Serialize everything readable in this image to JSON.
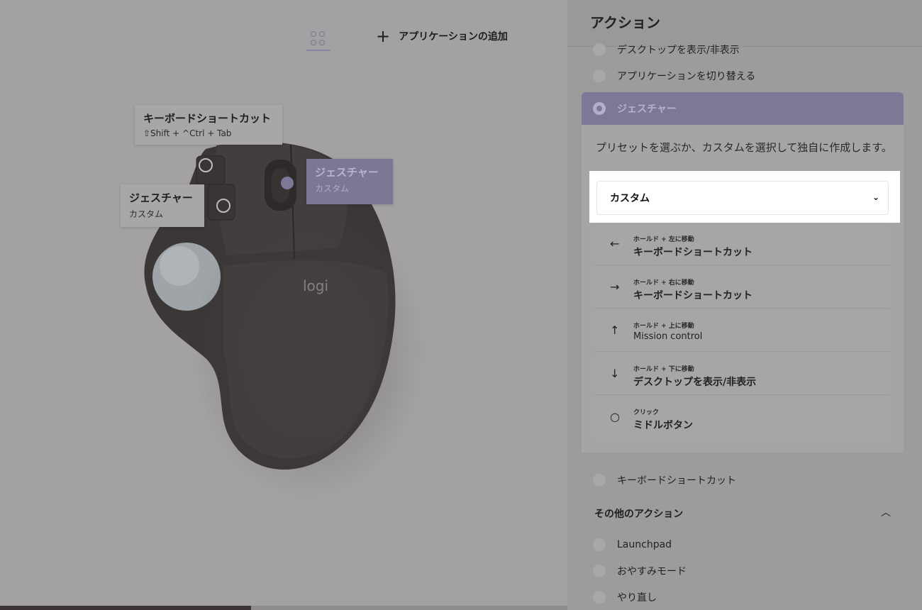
{
  "topbar": {
    "apps_icon": "grid-circles-icon",
    "add_app_label": "アプリケーションの追加",
    "add_icon": "plus-icon"
  },
  "mouse": {
    "brand_logo": "logi",
    "callouts": [
      {
        "title": "キーボードショートカット",
        "subtitle": "⇧Shift + ^Ctrl + Tab"
      },
      {
        "title": "ジェスチャー",
        "subtitle": "カスタム"
      },
      {
        "title": "ジェスチャー",
        "subtitle": "カスタム"
      }
    ]
  },
  "panel": {
    "title": "アクション",
    "options_top": [
      "デスクトップを表示/非表示",
      "アプリケーションを切り替える"
    ],
    "gesture": {
      "label": "ジェスチャー",
      "description": "プリセットを選ぶか、カスタムを選択して独自に作成します。",
      "select_value": "カスタム",
      "rows": [
        {
          "arrow": "←",
          "hint": "ホールド + 左に移動",
          "action": "キーボードショートカット"
        },
        {
          "arrow": "→",
          "hint": "ホールド + 右に移動",
          "action": "キーボードショートカット"
        },
        {
          "arrow": "↑",
          "hint": "ホールド + 上に移動",
          "action": "Mission control"
        },
        {
          "arrow": "↓",
          "hint": "ホールド + 下に移動",
          "action": "デスクトップを表示/非表示"
        },
        {
          "arrow": "○",
          "hint": "クリック",
          "action": "ミドルボタン"
        }
      ]
    },
    "option_keyboard": "キーボードショートカット",
    "more_actions": {
      "title": "その他のアクション",
      "items": [
        "Launchpad",
        "おやすみモード",
        "やり直し"
      ]
    }
  },
  "colors": {
    "accent": "#7d7896",
    "overlay": "#a3a1a1"
  }
}
